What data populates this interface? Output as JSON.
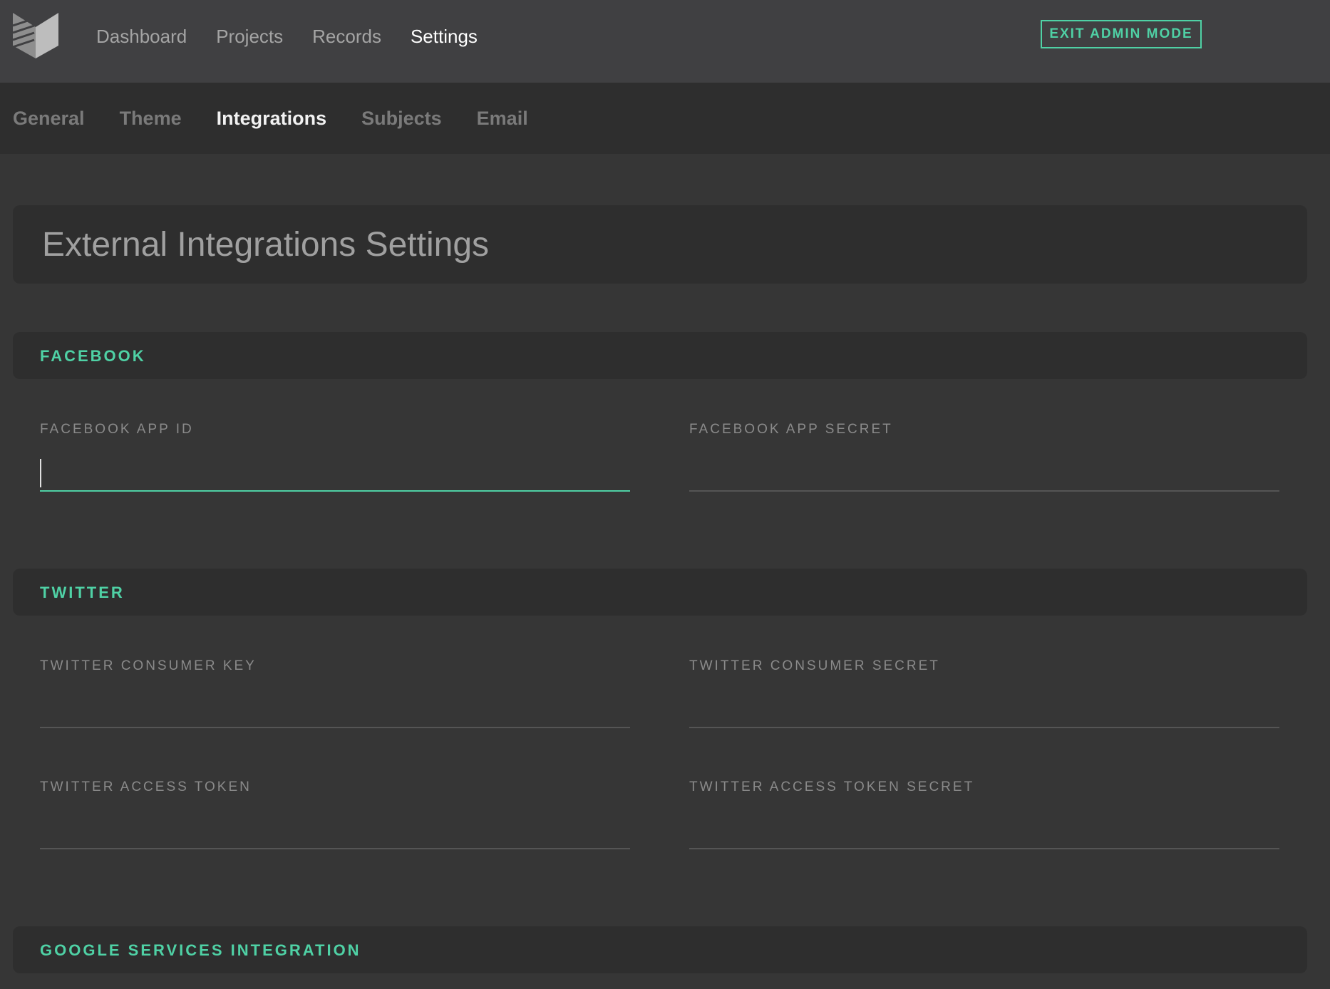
{
  "nav": {
    "items": [
      {
        "label": "Dashboard"
      },
      {
        "label": "Projects"
      },
      {
        "label": "Records"
      },
      {
        "label": "Settings",
        "active": true
      }
    ],
    "exit_button": "EXIT ADMIN MODE"
  },
  "subnav": {
    "tabs": [
      {
        "label": "General"
      },
      {
        "label": "Theme"
      },
      {
        "label": "Integrations",
        "active": true
      },
      {
        "label": "Subjects"
      },
      {
        "label": "Email"
      }
    ]
  },
  "page": {
    "title": "External Integrations Settings"
  },
  "sections": {
    "facebook": {
      "heading": "FACEBOOK",
      "app_id_label": "FACEBOOK APP ID",
      "app_id_value": "",
      "app_secret_label": "FACEBOOK APP SECRET",
      "app_secret_value": ""
    },
    "twitter": {
      "heading": "TWITTER",
      "consumer_key_label": "TWITTER CONSUMER KEY",
      "consumer_key_value": "",
      "consumer_secret_label": "TWITTER CONSUMER SECRET",
      "consumer_secret_value": "",
      "access_token_label": "TWITTER ACCESS TOKEN",
      "access_token_value": "",
      "access_token_secret_label": "TWITTER ACCESS TOKEN SECRET",
      "access_token_secret_value": ""
    },
    "google": {
      "heading": "GOOGLE SERVICES INTEGRATION"
    }
  },
  "colors": {
    "accent": "#4fd1a5",
    "topbar": "#404042",
    "subbar": "#2e2e2e",
    "background": "#363636"
  },
  "icons": {
    "logo": "app-logo-icon"
  }
}
